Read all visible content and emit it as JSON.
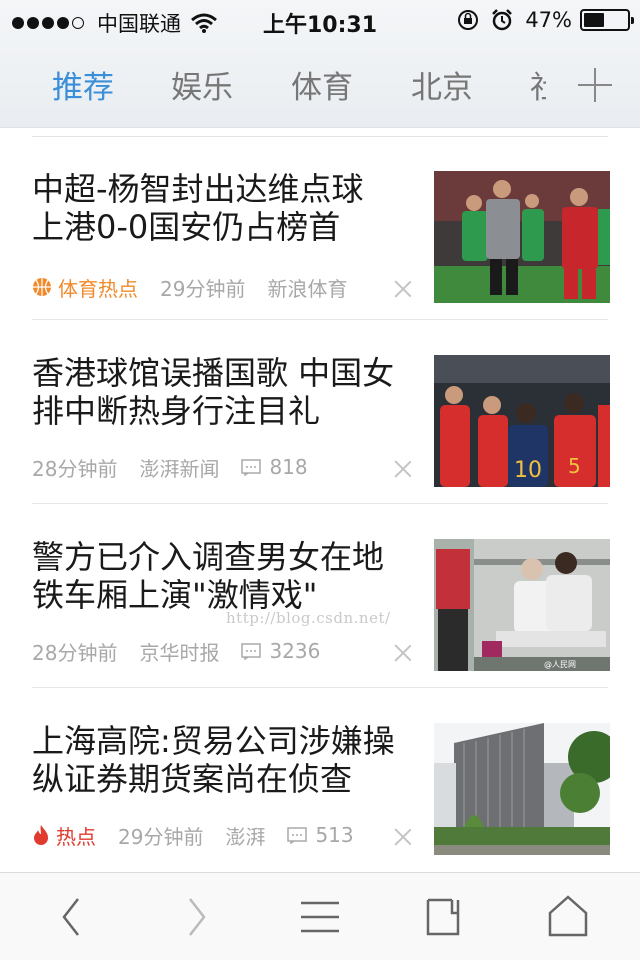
{
  "status_bar": {
    "carrier": "中国联通",
    "time": "上午10:31",
    "battery_percent_text": "47%",
    "battery_level": 0.47
  },
  "tabs": [
    {
      "label": "推荐",
      "active": true
    },
    {
      "label": "娱乐",
      "active": false
    },
    {
      "label": "体育",
      "active": false
    },
    {
      "label": "北京",
      "active": false
    },
    {
      "label": "社",
      "active": false
    }
  ],
  "articles": [
    {
      "title_line1": "中超-杨智封出达维点球",
      "title_line2": "上港0-0国安仍占榜首",
      "tag": "体育热点",
      "time": "29分钟前",
      "source": "新浪体育",
      "comments": ""
    },
    {
      "title_line1": "香港球馆误播国歌 中国女",
      "title_line2": "排中断热身行注目礼",
      "tag": "",
      "time": "28分钟前",
      "source": "澎湃新闻",
      "comments": "818"
    },
    {
      "title_line1": "警方已介入调查男女在地",
      "title_line2": "铁车厢上演\"激情戏\"",
      "tag": "",
      "time": "28分钟前",
      "source": "京华时报",
      "comments": "3236"
    },
    {
      "title_line1": "上海高院:贸易公司涉嫌操",
      "title_line2": "纵证券期货案尚在侦查",
      "tag": "热点",
      "time": "29分钟前",
      "source": "澎湃",
      "comments": "513"
    }
  ],
  "watermark": "http://blog.csdn.net/",
  "colors": {
    "active_tab": "#3b8fd9",
    "sport_tag": "#f08a2b",
    "hot_tag": "#e03b2e"
  },
  "toolbar_icons": [
    "back-icon",
    "forward-icon",
    "menu-icon",
    "tabs-icon",
    "home-icon"
  ]
}
